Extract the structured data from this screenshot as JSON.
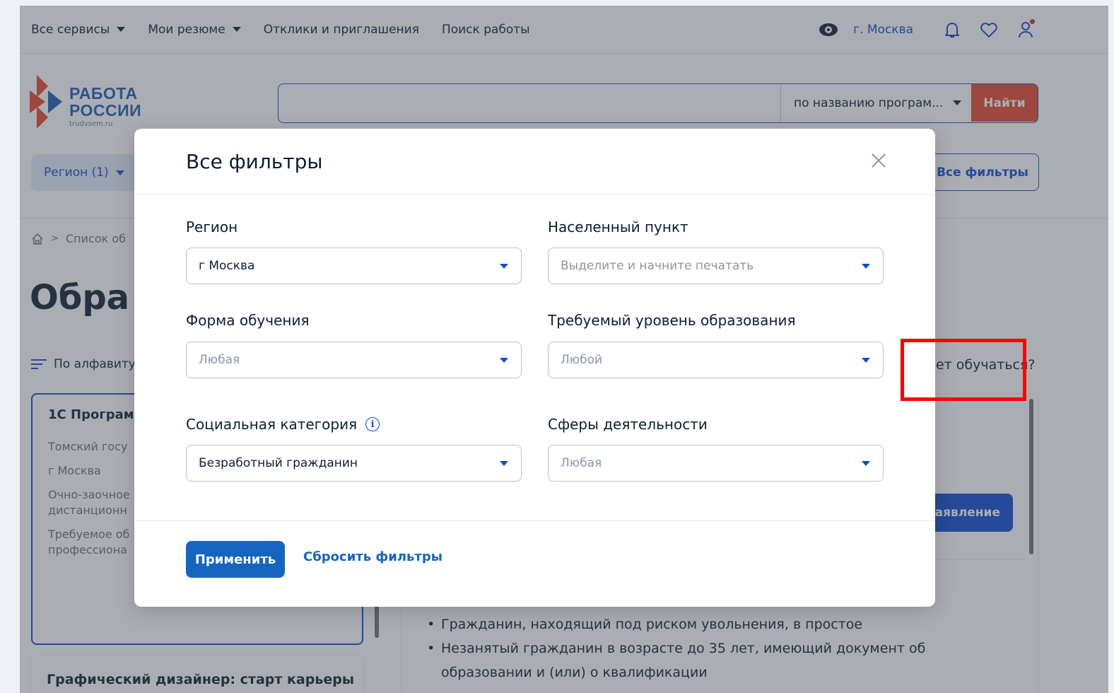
{
  "topbar": {
    "nav": [
      "Все сервисы",
      "Мои резюме",
      "Отклики и приглашения",
      "Поиск работы"
    ],
    "city": "г. Москва"
  },
  "header": {
    "logo_title_line1": "РАБОТА",
    "logo_title_line2": "РОССИИ",
    "logo_sub": "trudvsem.ru",
    "search_value": "",
    "search_mode": "по названию програм...",
    "search_button": "Найти"
  },
  "filters_bar": {
    "region_chip": "Регион (1)",
    "all_filters": "Все фильтры"
  },
  "breadcrumb": {
    "separator": ">",
    "item": "Список об"
  },
  "page": {
    "title": "Обра",
    "sort_label": "По алфавиту",
    "hint": "ет обучаться?"
  },
  "cards": [
    {
      "title": "1С Програм",
      "lines": [
        "Томский госу",
        "г Москва",
        "Очно-заочное дистанционн",
        "Требуемое об профессиона"
      ]
    },
    {
      "title": "Графический дизайнер: старт карьеры"
    }
  ],
  "detail": {
    "apply_label": "заявление",
    "bullets": [
      "Гражданин, находящий под риском увольнения, в простое",
      "Незанятый гражданин в возрасте до 35 лет, имеющий документ об образовании и (или) о квалификации"
    ]
  },
  "modal": {
    "title": "Все фильтры",
    "fields": {
      "region": {
        "label": "Регион",
        "value": "г Москва",
        "placeholder": ""
      },
      "locality": {
        "label": "Населенный пункт",
        "value": "",
        "placeholder": "Выделите и начните печатать"
      },
      "study_form": {
        "label": "Форма обучения",
        "value": "",
        "placeholder": "Любая"
      },
      "edu_level": {
        "label": "Требуемый уровень образования",
        "value": "",
        "placeholder": "Любой"
      },
      "social": {
        "label": "Социальная категория",
        "value": "Безработный гражданин",
        "placeholder": ""
      },
      "spheres": {
        "label": "Сферы деятельности",
        "value": "",
        "placeholder": "Любая"
      }
    },
    "apply_button": "Применить",
    "reset_button": "Сбросить фильтры"
  },
  "colors": {
    "accent": "#0d4cd3",
    "search_button": "#e8452c",
    "annotation": "#ff0000"
  },
  "icons": [
    "eye-icon",
    "bell-icon",
    "heart-icon",
    "user-icon",
    "home-icon",
    "sort-icon",
    "info-icon",
    "close-icon",
    "chevron-down-icon"
  ]
}
